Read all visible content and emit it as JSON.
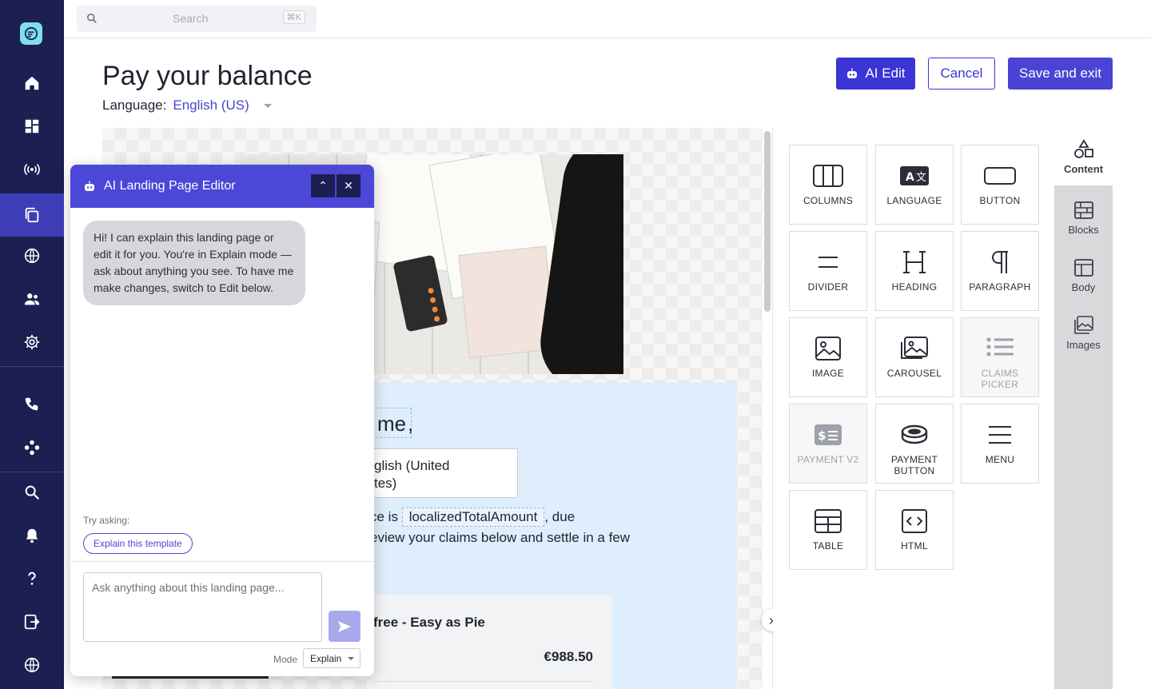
{
  "search": {
    "placeholder": "Search",
    "shortcut": "⌘K"
  },
  "page": {
    "title": "Pay your balance",
    "language_label": "Language:",
    "language_value": "English (US)"
  },
  "actions": {
    "ai_edit": "AI Edit",
    "cancel": "Cancel",
    "save": "Save and exit"
  },
  "sidebar": {
    "items": [
      "home-icon",
      "dashboard-icon",
      "broadcast-icon",
      "pages-icon",
      "globe-icon",
      "users-icon",
      "settings-icon",
      "phone-icon",
      "integrations-icon",
      "search-icon",
      "bell-icon",
      "help-icon",
      "logout-icon",
      "language-icon"
    ],
    "active": "pages-icon"
  },
  "preview": {
    "greeting_fragment": "me",
    "greeting_comma": ",",
    "language_box": "glish (United\ntes)",
    "line1_prefix": "ce is",
    "amount_token": "localizedTotalAmount",
    "line1_suffix": ", due",
    "line2": "eview your claims below and settle in a few",
    "claims_title": "free - Easy as Pie",
    "claims_amount": "€988.50"
  },
  "content_blocks": [
    {
      "label": "COLUMNS",
      "icon": "columns-icon",
      "enabled": true
    },
    {
      "label": "LANGUAGE",
      "icon": "language-icon",
      "enabled": true
    },
    {
      "label": "BUTTON",
      "icon": "button-icon",
      "enabled": true
    },
    {
      "label": "DIVIDER",
      "icon": "divider-icon",
      "enabled": true
    },
    {
      "label": "HEADING",
      "icon": "heading-icon",
      "enabled": true
    },
    {
      "label": "PARAGRAPH",
      "icon": "paragraph-icon",
      "enabled": true
    },
    {
      "label": "IMAGE",
      "icon": "image-icon",
      "enabled": true
    },
    {
      "label": "CAROUSEL",
      "icon": "carousel-icon",
      "enabled": true
    },
    {
      "label": "CLAIMS PICKER",
      "icon": "list-icon",
      "enabled": false
    },
    {
      "label": "PAYMENT V2",
      "icon": "payment-icon",
      "enabled": false
    },
    {
      "label": "PAYMENT BUTTON",
      "icon": "coin-icon",
      "enabled": true
    },
    {
      "label": "MENU",
      "icon": "menu-icon",
      "enabled": true
    },
    {
      "label": "TABLE",
      "icon": "table-icon",
      "enabled": true
    },
    {
      "label": "HTML",
      "icon": "code-icon",
      "enabled": true
    }
  ],
  "tabs": [
    {
      "label": "Content",
      "icon": "shapes-icon",
      "active": true
    },
    {
      "label": "Blocks",
      "icon": "blocks-icon",
      "active": false
    },
    {
      "label": "Body",
      "icon": "body-icon",
      "active": false
    },
    {
      "label": "Images",
      "icon": "images-icon",
      "active": false
    }
  ],
  "ai_editor": {
    "title": "AI Landing Page Editor",
    "collapse": "⌃",
    "close": "✕",
    "assistant_message": "Hi! I can explain this landing page or edit it for you. You're in Explain mode — ask about anything you see. To have me make changes, switch to Edit below.",
    "try_asking": "Try asking:",
    "suggestion": "Explain this template",
    "input_placeholder": "Ask anything about this landing page...",
    "mode_label": "Mode",
    "mode_value": "Explain"
  },
  "colors": {
    "sidebar": "#1b1f52",
    "accent": "#3b34d6",
    "sidebar_active": "#3d3db8",
    "ai_header": "#4b47d8"
  }
}
